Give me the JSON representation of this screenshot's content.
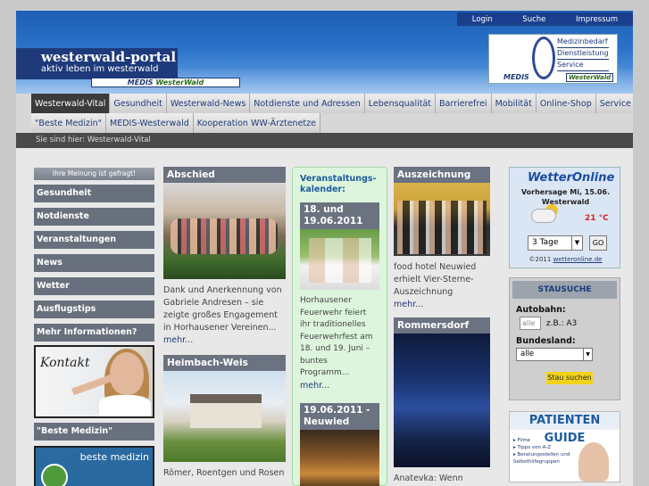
{
  "toplinks": [
    "Login",
    "Suche",
    "Impressum"
  ],
  "logo": {
    "title": "westerwald-portal",
    "subtitle": "aktiv leben im westerwald",
    "medis": "MEDIS",
    "ww": "WesterWald"
  },
  "header_logo": {
    "lines": [
      "Medizinbedarf",
      "Dienstleistung",
      "Service"
    ],
    "medis": "MEDIS",
    "ww": "WesterWald"
  },
  "nav1": [
    "Westerwald-Vital",
    "Gesundheit",
    "Westerwald-News",
    "Notdienste und Adressen",
    "Lebensqualität",
    "Barrierefrei",
    "Mobilität",
    "Online-Shop",
    "Service"
  ],
  "nav2": [
    "\"Beste Medizin\"",
    "MEDIS-Westerwald",
    "Kooperation WW-Ärztenetze"
  ],
  "breadcrumb": "Sie sind hier: Westerwald-Vital",
  "sidebar": {
    "poll": "Ihre Meinung ist gefragt!",
    "items": [
      "Gesundheit",
      "Notdienste",
      "Veranstaltungen",
      "News",
      "Wetter",
      "Ausflugstips",
      "Mehr Informationen?"
    ],
    "kontakt": "Kontakt",
    "beste": "\"Beste Medizin\"",
    "beste_img": "beste medizin"
  },
  "col2": [
    {
      "title": "Abschied",
      "text": "Dank und Anerkennung von Gabriele Andresen – sie zeigte großes Engagement in Horhausener Vereinen...",
      "more": "mehr..."
    },
    {
      "title": "Heimbach-Weis",
      "text": "Römer, Roentgen und Rosen",
      "more": ""
    }
  ],
  "col3": {
    "title": "Veranstaltungs-kalender:",
    "items": [
      {
        "title": "18. und 19.06.2011",
        "text": "Horhausener Feuerwehr feiert ihr traditionelles Feuerwehrfest am 18. und 19. Juni – buntes Programm...",
        "more": "mehr..."
      },
      {
        "title": "19.06.2011 - Neuwied",
        "text": "",
        "more": ""
      }
    ]
  },
  "col4": [
    {
      "title": "Auszeichnung",
      "text": "food hotel Neuwied erhielt Vier-Sterne-Auszeichnung",
      "more": "mehr..."
    },
    {
      "title": "Rommersdorf",
      "text": "Anatevka: Wenn",
      "more": ""
    }
  ],
  "wetter": {
    "logo": "WetterOnline",
    "line1": "Vorhersage Mi, 15.06.",
    "line2": "Westerwald",
    "temp": "21 °C",
    "select": "3 Tage",
    "go": "GO",
    "copy": "©2011",
    "copy_link": "wetteronline.de"
  },
  "stau": {
    "title": "STAUSUCHE",
    "autobahn_label": "Autobahn:",
    "autobahn_placeholder": "alle",
    "autobahn_example": "z.B.: A3",
    "land_label": "Bundesland:",
    "land_value": "alle",
    "button": "Stau suchen"
  },
  "guide": {
    "title": "PATIENTEN GUIDE",
    "lines": [
      "▸ Filme",
      "▸ Tipps von A-Z",
      "▸ Beratungsstellen und",
      "  Selbsthilfegruppen"
    ]
  }
}
